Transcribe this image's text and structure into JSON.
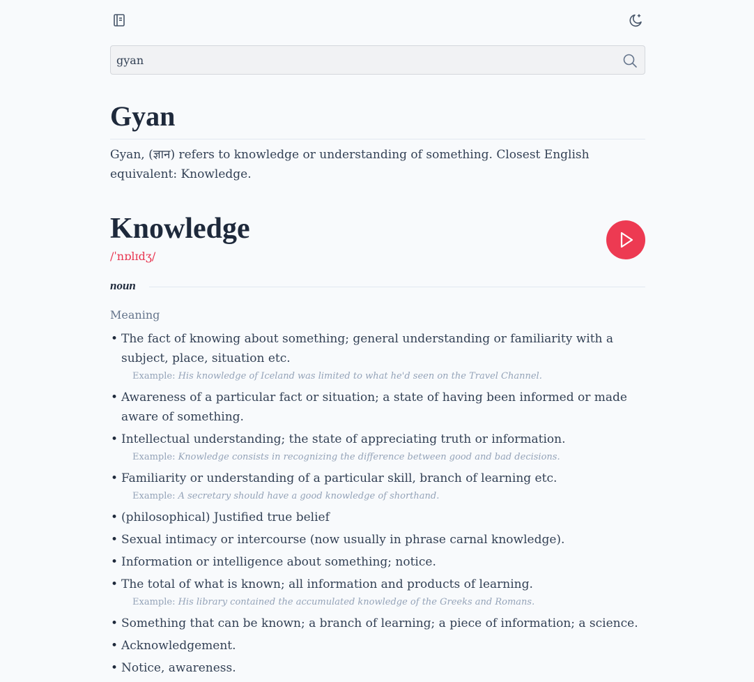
{
  "search": {
    "value": "gyan"
  },
  "word": {
    "title": "Gyan",
    "description": "Gyan, (ज्ञान) refers to knowledge or understanding of something. Closest English equivalent: Knowledge."
  },
  "english": {
    "title": "Knowledge",
    "phonetic": "/ˈnɒlɪdʒ/",
    "part_of_speech": "noun",
    "meaning_label": "Meaning",
    "example_label": "Example:",
    "meanings": [
      {
        "text": "The fact of knowing about something; general understanding or familiarity with a subject, place, situation etc.",
        "example": "His knowledge of Iceland was limited to what he'd seen on the Travel Channel."
      },
      {
        "text": "Awareness of a particular fact or situation; a state of having been informed or made aware of something.",
        "example": ""
      },
      {
        "text": "Intellectual understanding; the state of appreciating truth or information.",
        "example": "Knowledge consists in recognizing the difference between good and bad decisions."
      },
      {
        "text": "Familiarity or understanding of a particular skill, branch of learning etc.",
        "example": "A secretary should have a good knowledge of shorthand."
      },
      {
        "text": "(philosophical) Justified true belief",
        "example": ""
      },
      {
        "text": "Sexual intimacy or intercourse (now usually in phrase carnal knowledge).",
        "example": ""
      },
      {
        "text": "Information or intelligence about something; notice.",
        "example": ""
      },
      {
        "text": "The total of what is known; all information and products of learning.",
        "example": "His library contained the accumulated knowledge of the Greeks and Romans."
      },
      {
        "text": "Something that can be known; a branch of learning; a piece of information; a science.",
        "example": ""
      },
      {
        "text": "Acknowledgement.",
        "example": ""
      },
      {
        "text": "Notice, awareness.",
        "example": ""
      }
    ]
  },
  "icons": {
    "left": "book-icon",
    "right": "moon-icon",
    "search": "search-icon",
    "play": "play-icon"
  },
  "colors": {
    "accent": "#ed3a52",
    "background": "#f8fafc"
  }
}
